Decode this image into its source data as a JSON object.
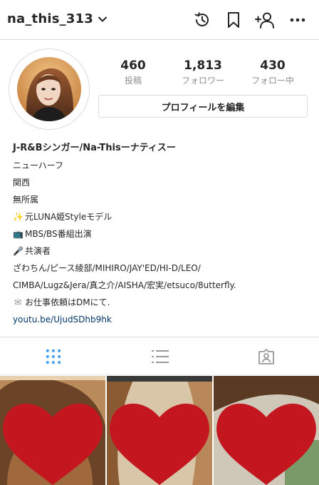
{
  "header": {
    "username": "na_this_313",
    "icons": [
      "archive-history-icon",
      "bookmark-icon",
      "discover-people-icon",
      "more-options-icon"
    ]
  },
  "profile": {
    "stats": [
      {
        "value": "460",
        "label": "投稿"
      },
      {
        "value": "1,813",
        "label": "フォロワー"
      },
      {
        "value": "430",
        "label": "フォロー中"
      }
    ],
    "edit_label": "プロフィールを編集"
  },
  "bio": {
    "name": "J-R&Bシンガー/Na-Thisーナティスー",
    "lines": [
      "ニューハーフ",
      "関西",
      "無所属",
      "元LUNA姫Styleモデル",
      "MBS/BS番組出演",
      "共演者",
      "ざわちん/ピース綾部/MIHIRO/JAY'ED/HI-D/LEO/",
      "CIMBA/Lugz&Jera/真之介/AISHA/宏実/etsuco/8utterfly.",
      "お仕事依頼はDMにて."
    ],
    "emojis": {
      "sparkles": "✨",
      "tv": "📺",
      "mic": "🎤",
      "envelope": "✉"
    },
    "link": "youtu.be/UjudSDhb9hk"
  },
  "tabs": [
    "grid-view-icon",
    "list-view-icon",
    "tagged-photos-icon"
  ],
  "colors": {
    "accent_blue": "#3897f0",
    "link": "#003569",
    "border": "#dbdbdb",
    "muted": "#8e8e8e",
    "heart_red": "#c4161f"
  }
}
